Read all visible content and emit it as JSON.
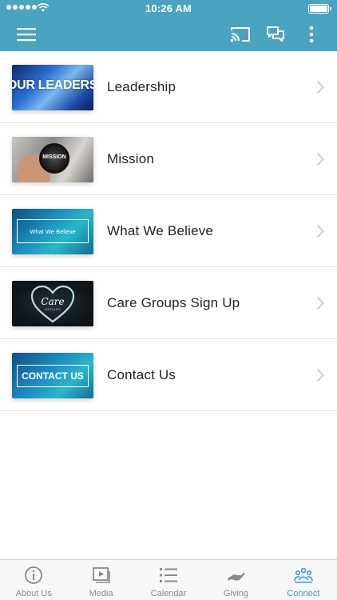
{
  "status_bar": {
    "time": "10:26 AM"
  },
  "colors": {
    "accent": "#4aa3bf",
    "active_tab": "#3d9bbb",
    "inactive_tab": "#8a8a8a"
  },
  "nav": {
    "icons": [
      "menu-icon",
      "cast-icon",
      "chat-icon",
      "more-vertical-icon"
    ]
  },
  "list": {
    "items": [
      {
        "label": "Leadership",
        "thumb_text": "OUR LEADERSHIP"
      },
      {
        "label": "Mission",
        "thumb_text": "MISSION"
      },
      {
        "label": "What We Believe",
        "thumb_text": "What We Believe"
      },
      {
        "label": "Care Groups Sign Up",
        "thumb_text": "Care",
        "thumb_subtext": "GROUPS"
      },
      {
        "label": "Contact Us",
        "thumb_text": "CONTACT US"
      }
    ]
  },
  "tabs": [
    {
      "label": "About Us",
      "icon": "info-icon",
      "active": false
    },
    {
      "label": "Media",
      "icon": "video-icon",
      "active": false
    },
    {
      "label": "Calendar",
      "icon": "list-icon",
      "active": false
    },
    {
      "label": "Giving",
      "icon": "giving-hand-icon",
      "active": false
    },
    {
      "label": "Connect",
      "icon": "people-icon",
      "active": true
    }
  ]
}
